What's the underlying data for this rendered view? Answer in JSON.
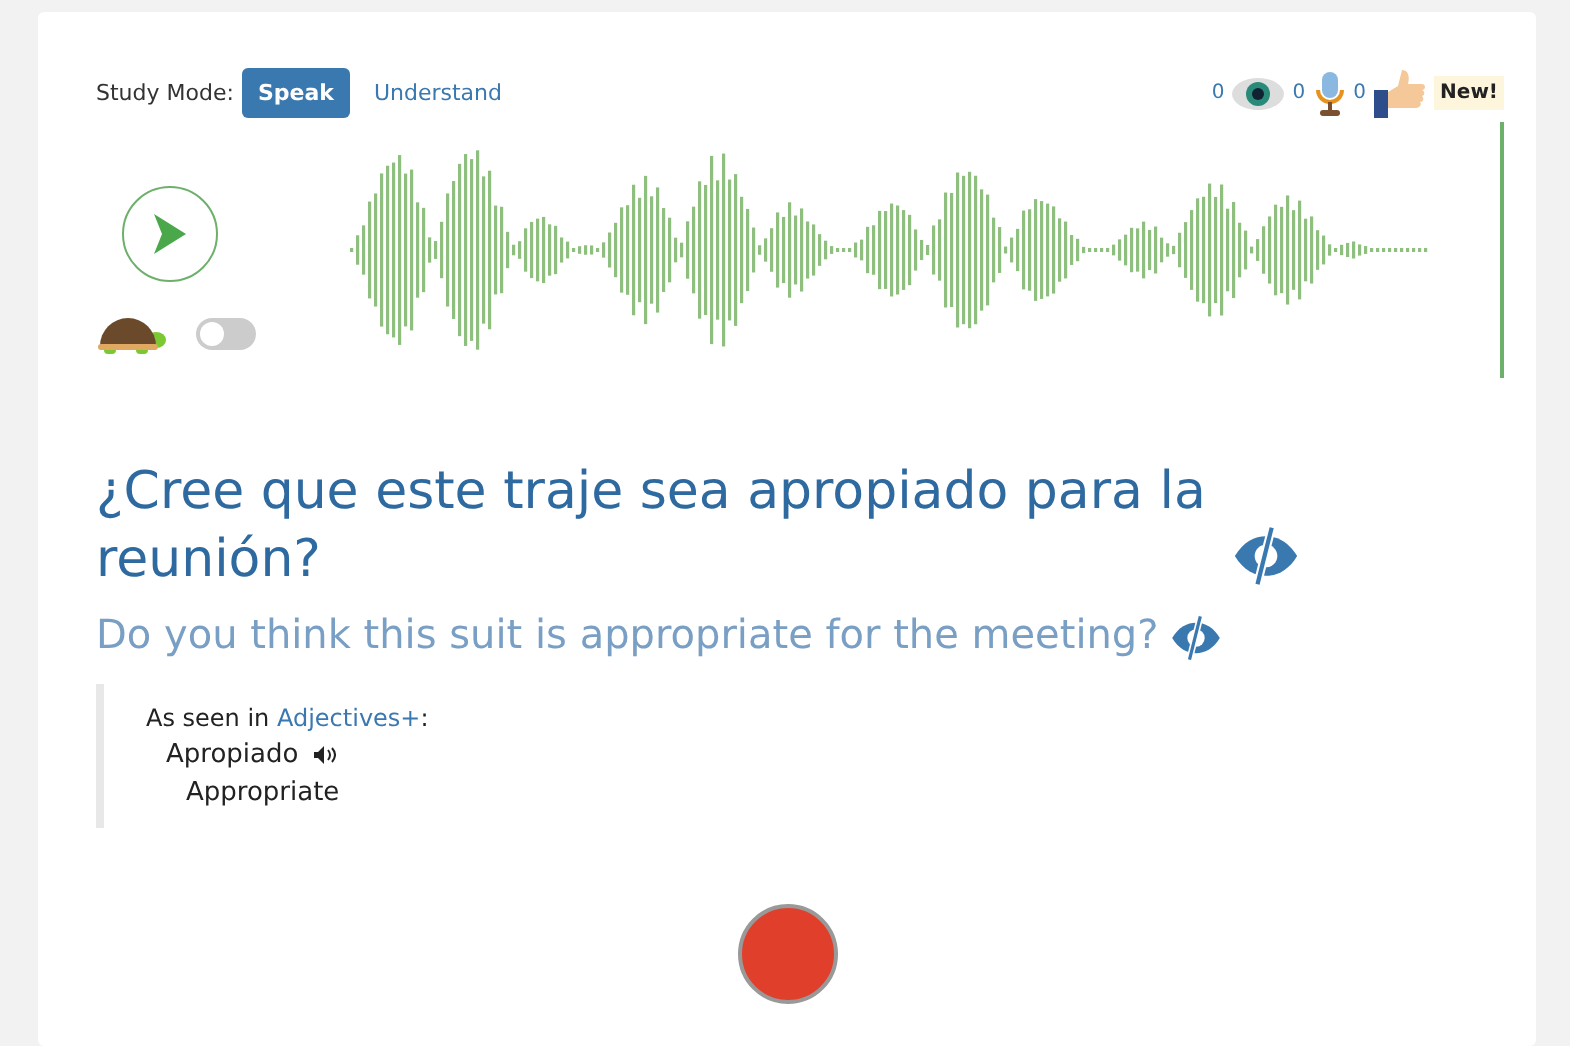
{
  "study_mode": {
    "label": "Study Mode:",
    "modes": [
      {
        "label": "Speak",
        "selected": true
      },
      {
        "label": "Understand",
        "selected": false
      }
    ]
  },
  "counters": [
    {
      "kind": "eye",
      "count": "0"
    },
    {
      "kind": "mic",
      "count": "0"
    },
    {
      "kind": "thumb",
      "count": "0"
    }
  ],
  "badge": "New!",
  "player": {
    "slow_toggle": {
      "on": false
    }
  },
  "sentence": {
    "text": "¿Cree que este traje sea apropiado para la reunión?",
    "translation": "Do you think this suit is appropriate for the meeting?"
  },
  "source": {
    "prefix": "As seen in ",
    "link": "Adjectives+",
    "suffix": ":",
    "word": "Apropiado",
    "meaning": "Appropriate"
  }
}
